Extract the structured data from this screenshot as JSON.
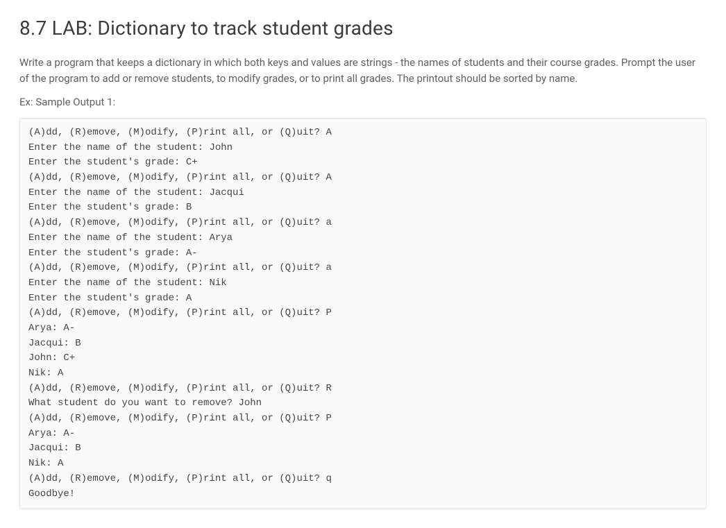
{
  "title": "8.7 LAB: Dictionary to track student grades",
  "description": "Write a program that keeps a dictionary in which both keys and values are strings - the names of students and their course grades. Prompt the user of the program to add or remove students, to modify grades, or to print all grades. The printout should be sorted by name.",
  "example_label": "Ex: Sample Output 1:",
  "sample_output": "(A)dd, (R)emove, (M)odify, (P)rint all, or (Q)uit? A\nEnter the name of the student: John\nEnter the student's grade: C+\n(A)dd, (R)emove, (M)odify, (P)rint all, or (Q)uit? A\nEnter the name of the student: Jacqui\nEnter the student's grade: B\n(A)dd, (R)emove, (M)odify, (P)rint all, or (Q)uit? a\nEnter the name of the student: Arya\nEnter the student's grade: A-\n(A)dd, (R)emove, (M)odify, (P)rint all, or (Q)uit? a\nEnter the name of the student: Nik\nEnter the student's grade: A\n(A)dd, (R)emove, (M)odify, (P)rint all, or (Q)uit? P\nArya: A-\nJacqui: B\nJohn: C+\nNik: A\n(A)dd, (R)emove, (M)odify, (P)rint all, or (Q)uit? R\nWhat student do you want to remove? John\n(A)dd, (R)emove, (M)odify, (P)rint all, or (Q)uit? P\nArya: A-\nJacqui: B\nNik: A\n(A)dd, (R)emove, (M)odify, (P)rint all, or (Q)uit? q\nGoodbye!"
}
